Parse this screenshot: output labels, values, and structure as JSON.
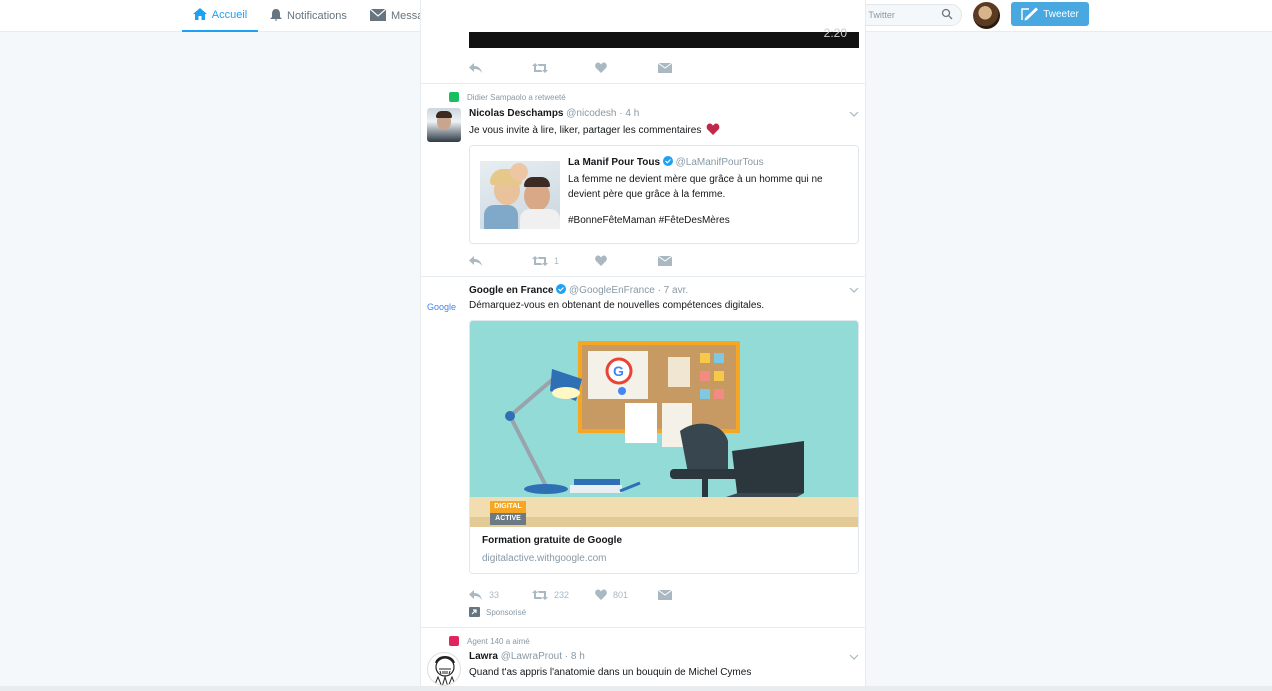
{
  "nav": {
    "home": "Accueil",
    "notifications": "Notifications",
    "messages": "Messages",
    "search_placeholder": "Recherchez sur Twitter",
    "tweet_button": "Tweeter"
  },
  "colors": {
    "accent": "#1da1f2",
    "like_heart": "#c0294a",
    "retweet_badge": "#17bf63",
    "liked_badge": "#e0245e"
  },
  "video_timestamp": "2:20",
  "tweets": [
    {
      "context": "Didier Sampaolo a retweeté",
      "name": "Nicolas Deschamps",
      "handle": "@nicodesh",
      "time": "· 4 h",
      "text": "Je vous invite à lire, liker, partager les commentaires",
      "quote": {
        "name": "La Manif Pour Tous",
        "handle": "@LaManifPourTous",
        "line1": "La femme ne devient mère que grâce à un homme qui ne",
        "line2": "devient père que grâce à la femme.",
        "hashtags": "#BonneFêteMaman #FêteDesMères"
      },
      "retweets": "1"
    },
    {
      "name": "Google en France",
      "handle": "@GoogleEnFrance",
      "time": "· 7 avr.",
      "avatar_text": "Google",
      "text": "Démarquez-vous en obtenant de nouvelles compétences digitales.",
      "card_badge_top": "DIGITAL",
      "card_badge_bottom": "ACTIVE",
      "card_title": "Formation gratuite de Google",
      "card_url": "digitalactive.withgoogle.com",
      "replies": "33",
      "retweets": "232",
      "likes": "801",
      "sponsored": "Sponsorisé"
    },
    {
      "context": "Agent 140 a aimé",
      "name": "Lawra",
      "handle": "@LawraProut",
      "time": "· 8 h",
      "text": "Quand t'as appris l'anatomie dans un bouquin de Michel Cymes"
    }
  ]
}
